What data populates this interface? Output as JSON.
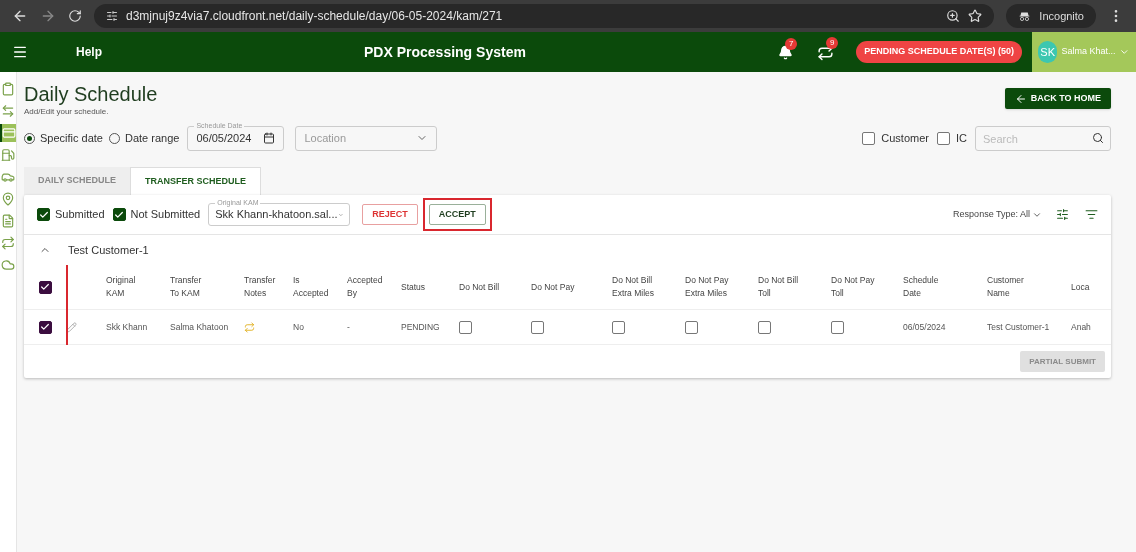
{
  "browser": {
    "url": "d3mjnuj9z4via7.cloudfront.net/daily-schedule/day/06-05-2024/kam/271",
    "profile": "Incognito"
  },
  "header": {
    "help": "Help",
    "title": "PDX Processing System",
    "notifications": "7",
    "transfers": "9",
    "pending": "PENDING SCHEDULE DATE(S) (50)",
    "avatar": "SK",
    "user": "Salma Khat..."
  },
  "sidebar": {
    "items": [
      {
        "kind": "clipboard",
        "selected": false
      },
      {
        "kind": "transfer",
        "selected": false
      },
      {
        "kind": "card",
        "selected": true
      },
      {
        "kind": "fuel",
        "selected": false
      },
      {
        "kind": "car",
        "selected": false
      },
      {
        "kind": "pin",
        "selected": false
      },
      {
        "kind": "doc",
        "selected": false
      },
      {
        "kind": "swap",
        "selected": false
      },
      {
        "kind": "cloud",
        "selected": false
      }
    ]
  },
  "page": {
    "title": "Daily Schedule",
    "subtitle": "Add/Edit your schedule.",
    "back": "BACK TO HOME"
  },
  "filters": {
    "modes": [
      {
        "label": "Specific date",
        "selected": true
      },
      {
        "label": "Date range",
        "selected": false
      }
    ],
    "date_label": "Schedule Date",
    "date": "06/05/2024",
    "location_placeholder": "Location",
    "checks": [
      {
        "label": "Customer",
        "checked": false
      },
      {
        "label": "IC",
        "checked": false
      }
    ],
    "search_placeholder": "Search"
  },
  "tabs": [
    {
      "label": "DAILY SCHEDULE",
      "selected": false
    },
    {
      "label": "TRANSFER SCHEDULE",
      "selected": true
    }
  ],
  "toolbar": {
    "checks": [
      {
        "label": "Submitted",
        "checked": true
      },
      {
        "label": "Not Submitted",
        "checked": true
      }
    ],
    "kam_label": "Original KAM",
    "kam": "Skk Khann-khatoon.sal...",
    "reject": "REJECT",
    "accept": "ACCEPT",
    "accept_highlighted": true,
    "response": "Response Type: All"
  },
  "group": {
    "label": "Test Customer-1",
    "expanded": true
  },
  "table": {
    "select_all": true,
    "select_highlighted": true,
    "columns": [
      "Original\nKAM",
      "Transfer\nTo KAM",
      "Transfer\nNotes",
      "Is\nAccepted",
      "Accepted\nBy",
      "Status",
      "Do Not Bill",
      "Do Not Pay",
      "Do Not Bill\nExtra Miles",
      "Do Not Pay\nExtra Miles",
      "Do Not Bill\nToll",
      "Do Not Pay\nToll",
      "Schedule\nDate",
      "Customer\nName",
      "Loca"
    ],
    "rows": [
      {
        "selected": true,
        "cells": [
          {
            "kind": "text",
            "text": "Skk Khann"
          },
          {
            "kind": "text",
            "text": "Salma Khatoon"
          },
          {
            "kind": "icon"
          },
          {
            "kind": "text",
            "text": "No"
          },
          {
            "kind": "text",
            "text": "-"
          },
          {
            "kind": "text",
            "text": "PENDING"
          },
          {
            "kind": "check",
            "checked": false
          },
          {
            "kind": "check",
            "checked": false
          },
          {
            "kind": "check",
            "checked": false
          },
          {
            "kind": "check",
            "checked": false
          },
          {
            "kind": "check",
            "checked": false
          },
          {
            "kind": "check",
            "checked": false
          },
          {
            "kind": "text",
            "text": "06/05/2024"
          },
          {
            "kind": "text",
            "text": "Test Customer-1"
          },
          {
            "kind": "text",
            "text": "Anah"
          }
        ]
      }
    ]
  },
  "partial_submit": {
    "label": "PARTIAL SUBMIT",
    "disabled": true
  }
}
